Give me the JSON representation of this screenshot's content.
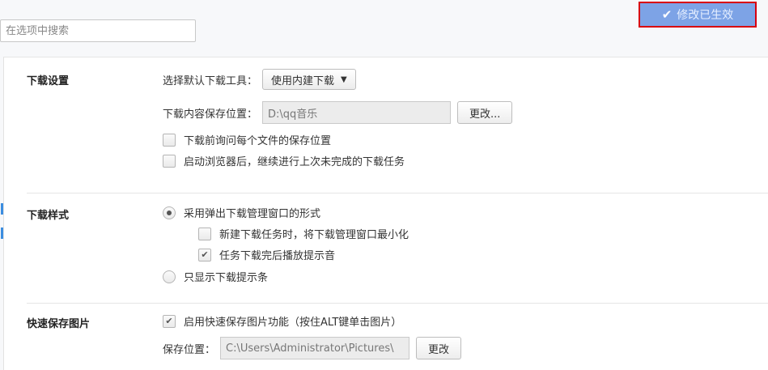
{
  "search": {
    "placeholder": "在选项中搜索"
  },
  "status_badge": {
    "label": "修改已生效",
    "check_icon": "✔"
  },
  "download_settings": {
    "title": "下载设置",
    "default_tool_label": "选择默认下载工具：",
    "default_tool_value": "使用内建下载",
    "save_location_label": "下载内容保存位置：",
    "save_location_value": "D:\\qq音乐",
    "change_button": "更改...",
    "ask_each_file": {
      "label": "下载前询问每个文件的保存位置",
      "checked": false
    },
    "resume_on_start": {
      "label": "启动浏览器后，继续进行上次未完成的下载任务",
      "checked": false
    }
  },
  "download_style": {
    "title": "下载样式",
    "popup_mode": {
      "label": "采用弹出下载管理窗口的形式",
      "selected": true
    },
    "minimize_on_new": {
      "label": "新建下载任务时，将下载管理窗口最小化",
      "checked": false
    },
    "sound_on_complete": {
      "label": "任务下载完后播放提示音",
      "checked": true
    },
    "bar_only_mode": {
      "label": "只显示下载提示条",
      "selected": false
    }
  },
  "quick_save_image": {
    "title": "快速保存图片",
    "enable": {
      "label": "启用快速保存图片功能（按住ALT键单击图片）",
      "checked": true
    },
    "location_label": "保存位置：",
    "location_value": "C:\\Users\\Administrator\\Pictures\\",
    "change_button": "更改"
  },
  "colors": {
    "accent_blue": "#3b8de0",
    "badge_bg": "#7da3e6",
    "highlight_red": "#d8000f"
  }
}
